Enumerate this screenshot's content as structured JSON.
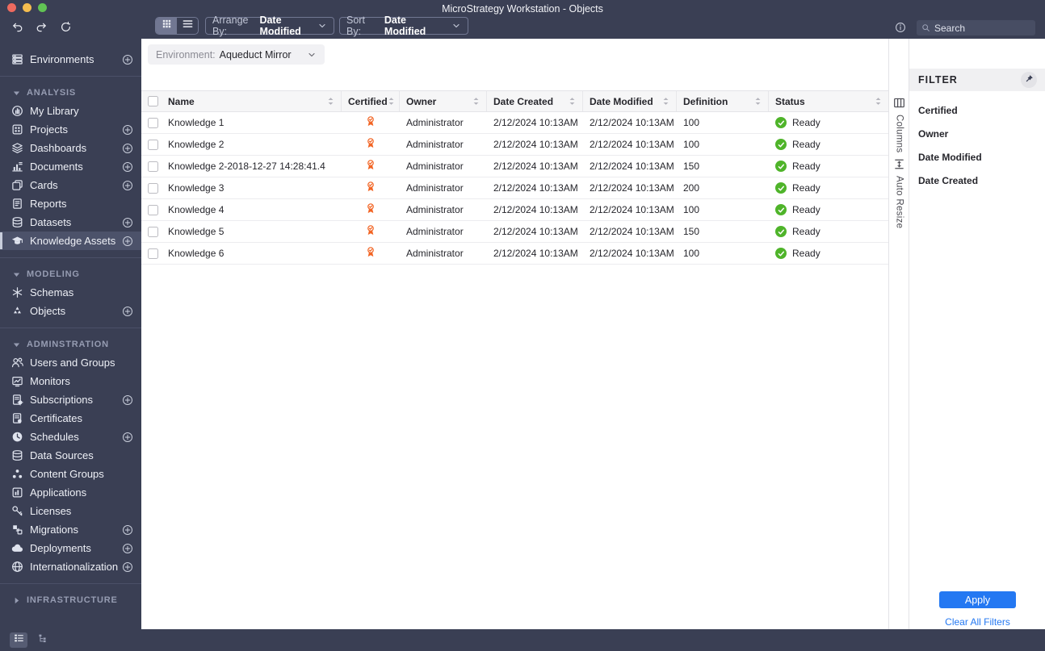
{
  "window": {
    "title": "MicroStrategy Workstation - Objects"
  },
  "toolbar": {
    "arrange_label": "Arrange By:",
    "arrange_value": "Date Modified",
    "sort_label": "Sort By:",
    "sort_value": "Date Modified",
    "search_placeholder": "Search"
  },
  "environment": {
    "label": "Environment:",
    "value": "Aqueduct Mirror"
  },
  "sidebar": {
    "sections": [
      {
        "items": [
          {
            "label": "Environments",
            "icon": "environments",
            "plus": true
          }
        ]
      },
      {
        "header": {
          "label": "ANALYSIS",
          "collapsed": false
        },
        "items": [
          {
            "label": "My Library",
            "icon": "my-library"
          },
          {
            "label": "Projects",
            "icon": "projects",
            "plus": true
          },
          {
            "label": "Dashboards",
            "icon": "dashboards",
            "plus": true
          },
          {
            "label": "Documents",
            "icon": "documents",
            "plus": true
          },
          {
            "label": "Cards",
            "icon": "cards",
            "plus": true
          },
          {
            "label": "Reports",
            "icon": "reports"
          },
          {
            "label": "Datasets",
            "icon": "datasets",
            "plus": true
          },
          {
            "label": "Knowledge Assets",
            "icon": "knowledge-assets",
            "plus": true,
            "selected": true
          }
        ]
      },
      {
        "header": {
          "label": "MODELING",
          "collapsed": false
        },
        "items": [
          {
            "label": "Schemas",
            "icon": "schemas"
          },
          {
            "label": "Objects",
            "icon": "objects",
            "plus": true
          }
        ]
      },
      {
        "header": {
          "label": "ADMINSTRATION",
          "collapsed": false
        },
        "items": [
          {
            "label": "Users and Groups",
            "icon": "users-and-groups"
          },
          {
            "label": "Monitors",
            "icon": "monitors"
          },
          {
            "label": "Subscriptions",
            "icon": "subscriptions",
            "plus": true
          },
          {
            "label": "Certificates",
            "icon": "certificates"
          },
          {
            "label": "Schedules",
            "icon": "schedules",
            "plus": true
          },
          {
            "label": "Data Sources",
            "icon": "data-sources"
          },
          {
            "label": "Content Groups",
            "icon": "content-groups"
          },
          {
            "label": "Applications",
            "icon": "applications"
          },
          {
            "label": "Licenses",
            "icon": "licenses"
          },
          {
            "label": "Migrations",
            "icon": "migrations",
            "plus": true
          },
          {
            "label": "Deployments",
            "icon": "deployments",
            "plus": true
          },
          {
            "label": "Internationalization",
            "icon": "internationalization",
            "plus": true
          }
        ]
      },
      {
        "header": {
          "label": "INFRASTRUCTURE",
          "collapsed": true
        },
        "items": []
      }
    ]
  },
  "table": {
    "columns": [
      "Name",
      "Certified",
      "Owner",
      "Date Created",
      "Date Modified",
      "Definition",
      "Status"
    ],
    "rows": [
      {
        "name": "Knowledge 1",
        "certified": true,
        "owner": "Administrator",
        "date_created": "2/12/2024 10:13AM",
        "date_modified": "2/12/2024 10:13AM",
        "definition": "100",
        "status": "Ready"
      },
      {
        "name": "Knowledge 2",
        "certified": true,
        "owner": "Administrator",
        "date_created": "2/12/2024 10:13AM",
        "date_modified": "2/12/2024 10:13AM",
        "definition": "100",
        "status": "Ready"
      },
      {
        "name": "Knowledge 2-2018-12-27 14:28:41.4",
        "certified": true,
        "owner": "Administrator",
        "date_created": "2/12/2024 10:13AM",
        "date_modified": "2/12/2024 10:13AM",
        "definition": "150",
        "status": "Ready"
      },
      {
        "name": "Knowledge 3",
        "certified": true,
        "owner": "Administrator",
        "date_created": "2/12/2024 10:13AM",
        "date_modified": "2/12/2024 10:13AM",
        "definition": "200",
        "status": "Ready"
      },
      {
        "name": "Knowledge 4",
        "certified": true,
        "owner": "Administrator",
        "date_created": "2/12/2024 10:13AM",
        "date_modified": "2/12/2024 10:13AM",
        "definition": "100",
        "status": "Ready"
      },
      {
        "name": "Knowledge 5",
        "certified": true,
        "owner": "Administrator",
        "date_created": "2/12/2024 10:13AM",
        "date_modified": "2/12/2024 10:13AM",
        "definition": "150",
        "status": "Ready"
      },
      {
        "name": "Knowledge 6",
        "certified": true,
        "owner": "Administrator",
        "date_created": "2/12/2024 10:13AM",
        "date_modified": "2/12/2024 10:13AM",
        "definition": "100",
        "status": "Ready"
      }
    ]
  },
  "side_strip": {
    "columns_label": "Columns",
    "auto_resize_label": "Auto Resize"
  },
  "filter": {
    "title": "FILTER",
    "items": [
      "Certified",
      "Owner",
      "Date Modified",
      "Date Created"
    ],
    "apply_label": "Apply",
    "clear_label": "Clear All Filters"
  },
  "colors": {
    "navy": "#3A3F54",
    "accent_blue": "#2478F2",
    "certified_orange": "#F26322",
    "ready_green": "#4FB42A"
  }
}
